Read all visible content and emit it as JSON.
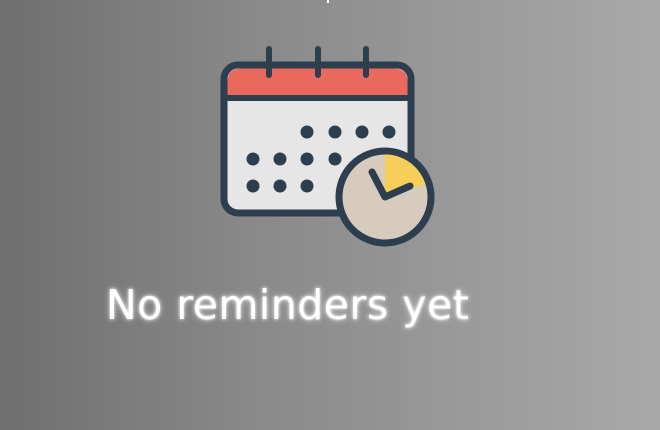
{
  "empty_state": {
    "message": "No reminders yet",
    "icon": "calendar-clock-icon"
  },
  "colors": {
    "background_left": "#6f6f6f",
    "background_right": "#a9a9a9",
    "calendar_header": "#e96a5d",
    "calendar_body": "#e6e6e6",
    "outline": "#2d3e4e",
    "clock_face": "#d6cbbc",
    "clock_accent": "#f6ce58",
    "message_text": "#ffffff"
  }
}
